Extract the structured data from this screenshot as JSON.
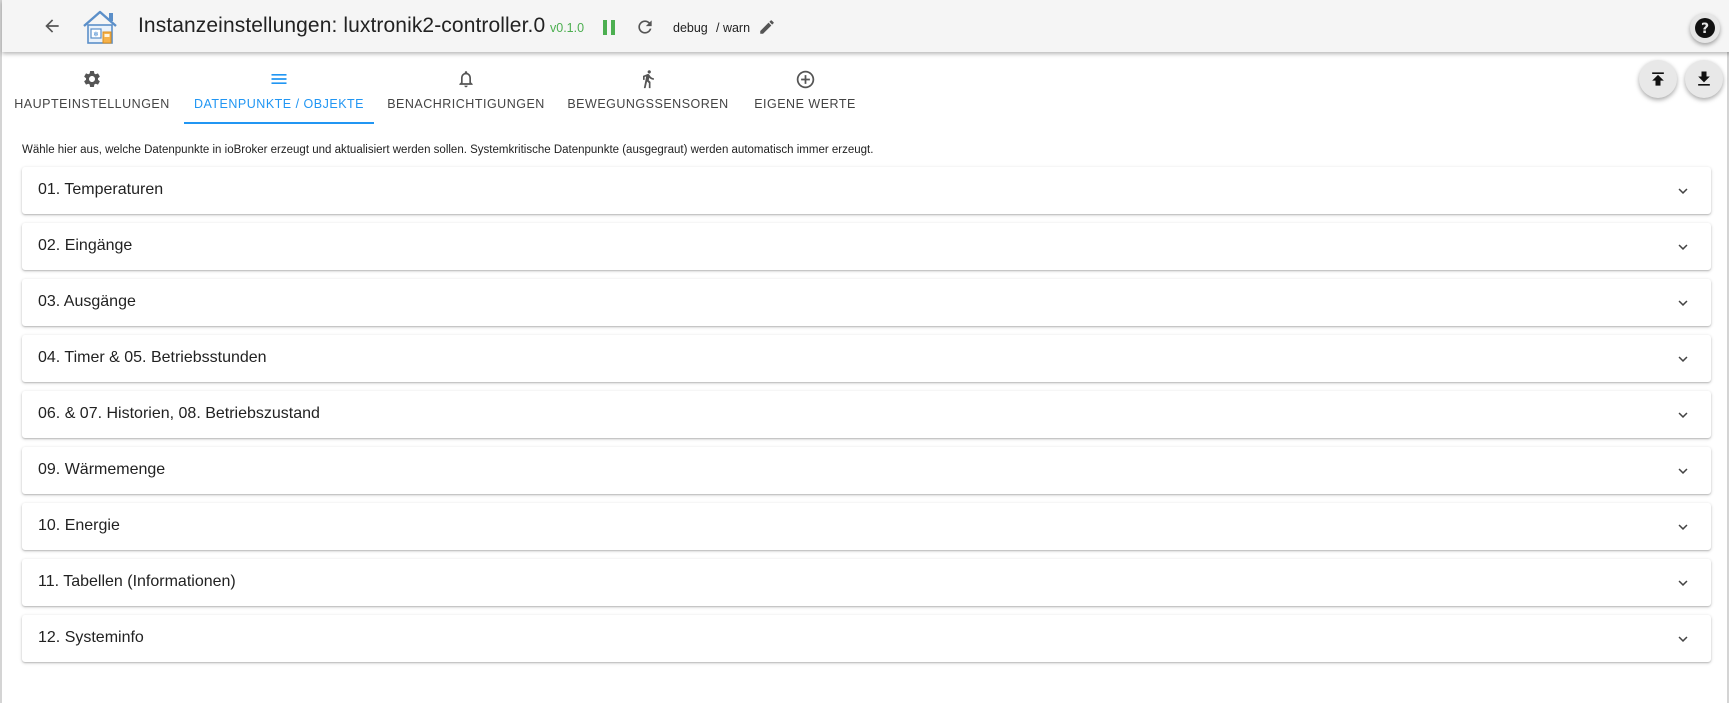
{
  "header": {
    "title": "Instanzeinstellungen: luxtronik2-controller.0",
    "version": "v0.1.0",
    "log_level": "debug",
    "log_level_separator": "/ warn",
    "icons": {
      "back": "arrow-left-icon",
      "logo": "house-logo-icon",
      "pause": "pause-icon",
      "restart": "restart-icon",
      "edit": "pencil-icon",
      "help": "help-icon"
    }
  },
  "tabs": [
    {
      "label": "HAUPTEINSTELLUNGEN",
      "icon": "gear-icon"
    },
    {
      "label": "DATENPUNKTE / OBJEKTE",
      "icon": "list-icon",
      "active": true
    },
    {
      "label": "BENACHRICHTIGUNGEN",
      "icon": "bell-icon"
    },
    {
      "label": "BEWEGUNGSSENSOREN",
      "icon": "walking-person-icon"
    },
    {
      "label": "EIGENE WERTE",
      "icon": "plus-circle-icon"
    }
  ],
  "actions": {
    "upload_icon": "upload-icon",
    "download_icon": "download-icon"
  },
  "intro_text": "Wähle hier aus, welche Datenpunkte in ioBroker erzeugt und aktualisiert werden sollen. Systemkritische Datenpunkte (ausgegraut) werden automatisch immer erzeugt.",
  "sections": [
    {
      "title": "01. Temperaturen"
    },
    {
      "title": "02. Eingänge"
    },
    {
      "title": "03. Ausgänge"
    },
    {
      "title": "04. Timer & 05. Betriebsstunden"
    },
    {
      "title": "06. & 07. Historien, 08. Betriebszustand"
    },
    {
      "title": "09. Wärmemenge"
    },
    {
      "title": "10. Energie"
    },
    {
      "title": "11. Tabellen (Informationen)"
    },
    {
      "title": "12. Systeminfo"
    }
  ],
  "colors": {
    "accent": "#2196f3",
    "version_green": "#4caf50",
    "header_bg": "#f5f5f5"
  }
}
